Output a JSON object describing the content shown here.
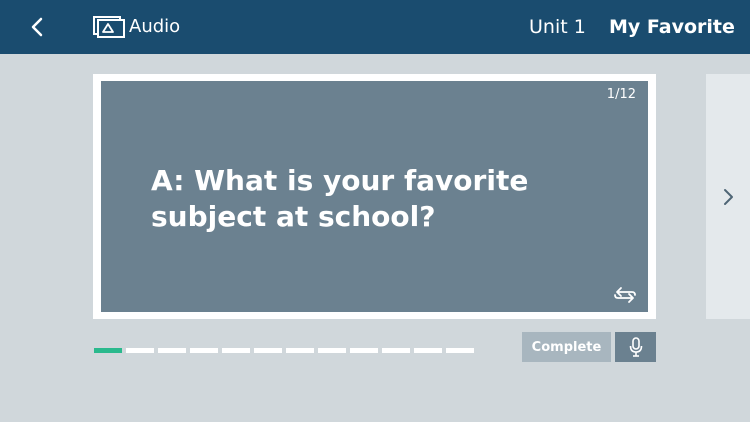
{
  "header": {
    "back_icon": "chevron-left-icon",
    "mode_icon": "slideshow-icon",
    "mode_label": "Audio",
    "unit_label": "Unit 1",
    "lesson_title": "My Favorite"
  },
  "card": {
    "page_counter": "1/12",
    "text": "A: What is your favorite subject at school?",
    "flip_icon": "flip-arrows-icon"
  },
  "navigation": {
    "next_icon": "chevron-right-icon"
  },
  "progress": {
    "current": 1,
    "total": 12
  },
  "actions": {
    "complete_label": "Complete",
    "mic_icon": "microphone-icon"
  },
  "colors": {
    "header_bg": "#1a4c6f",
    "card_bg": "#6b8190",
    "progress_active": "#2ab98d",
    "page_bg": "#d0d7db"
  }
}
